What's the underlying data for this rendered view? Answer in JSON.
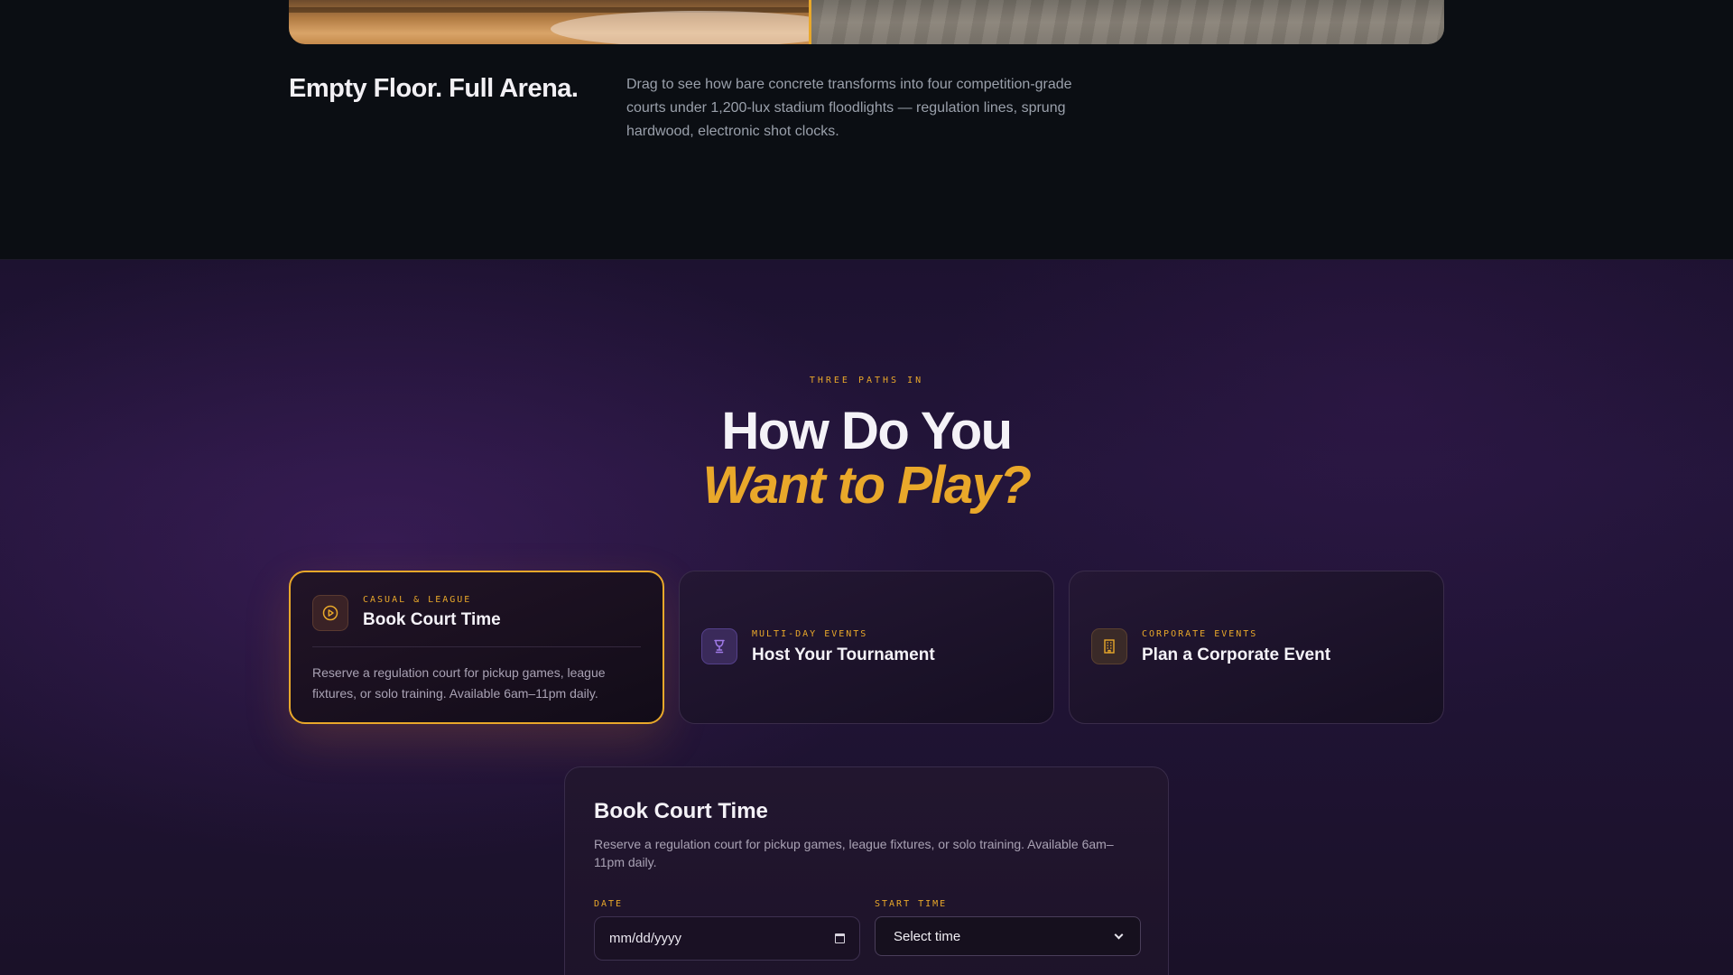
{
  "hero": {
    "title": "Empty Floor. Full Arena.",
    "description": "Drag to see how bare concrete transforms into four competition-grade courts under 1,200-lux stadium floodlights — regulation lines, sprung hardwood, electronic shot clocks."
  },
  "paths": {
    "eyebrow": "THREE PATHS IN",
    "headline_line1": "How Do You",
    "headline_line2": "Want to Play?",
    "cards": [
      {
        "tag": "CASUAL & LEAGUE",
        "title": "Book Court Time",
        "description": "Reserve a regulation court for pickup games, league fixtures, or solo training. Available 6am–11pm daily.",
        "icon": "play-circle-icon",
        "active": true
      },
      {
        "tag": "MULTI-DAY EVENTS",
        "title": "Host Your Tournament",
        "icon": "trophy-icon",
        "active": false
      },
      {
        "tag": "CORPORATE EVENTS",
        "title": "Plan a Corporate Event",
        "icon": "building-icon",
        "active": false
      }
    ]
  },
  "form": {
    "title": "Book Court Time",
    "description": "Reserve a regulation court for pickup games, league fixtures, or solo training. Available 6am–11pm daily.",
    "date_label": "DATE",
    "date_placeholder": "mm/dd/yyyy",
    "time_label": "START TIME",
    "time_value": "Select time"
  },
  "colors": {
    "accent": "#e9a82a",
    "background_top": "#0b0e13",
    "background_purple": "#23153a"
  }
}
